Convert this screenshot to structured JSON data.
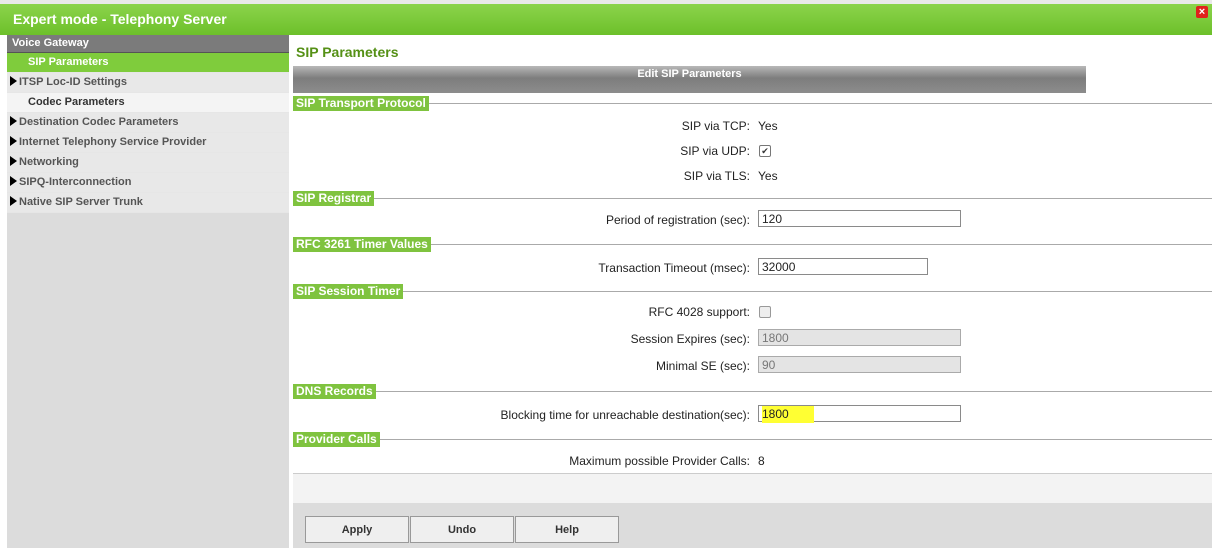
{
  "window": {
    "title": "Expert mode - Telephony Server"
  },
  "sidebar": {
    "header": "Voice Gateway",
    "items": [
      {
        "label": "SIP Parameters",
        "active": true,
        "arrow": false
      },
      {
        "label": "ITSP Loc-ID Settings",
        "active": false,
        "arrow": true
      },
      {
        "label": "Codec Parameters",
        "active": false,
        "arrow": false
      },
      {
        "label": "Destination Codec Parameters",
        "active": false,
        "arrow": true
      },
      {
        "label": "Internet Telephony Service Provider",
        "active": false,
        "arrow": true
      },
      {
        "label": "Networking",
        "active": false,
        "arrow": true
      },
      {
        "label": "SIPQ-Interconnection",
        "active": false,
        "arrow": true
      },
      {
        "label": "Native SIP Server Trunk",
        "active": false,
        "arrow": true
      }
    ]
  },
  "main": {
    "title": "SIP Parameters",
    "edit_bar": "Edit SIP Parameters",
    "sections": {
      "transport": {
        "title": "SIP Transport Protocol",
        "tcp_label": "SIP via TCP:",
        "tcp_value": "Yes",
        "udp_label": "SIP via UDP:",
        "udp_checked": true,
        "tls_label": "SIP via TLS:",
        "tls_value": "Yes"
      },
      "registrar": {
        "title": "SIP Registrar",
        "period_label": "Period of registration (sec):",
        "period_value": "120"
      },
      "rfc3261": {
        "title": "RFC 3261 Timer Values",
        "timeout_label": "Transaction Timeout (msec):",
        "timeout_value": "32000"
      },
      "session": {
        "title": "SIP Session Timer",
        "rfc4028_label": "RFC 4028 support:",
        "rfc4028_checked": false,
        "expires_label": "Session Expires (sec):",
        "expires_value": "1800",
        "minse_label": "Minimal SE (sec):",
        "minse_value": "90"
      },
      "dns": {
        "title": "DNS Records",
        "blocking_label": "Blocking time for unreachable destination(sec):",
        "blocking_value": "1800"
      },
      "provider": {
        "title": "Provider Calls",
        "max_label": "Maximum possible Provider Calls:",
        "max_value": "8"
      }
    },
    "buttons": {
      "apply": "Apply",
      "undo": "Undo",
      "help": "Help"
    }
  },
  "colors": {
    "accent": "#7fc33f",
    "title_green": "#559016",
    "highlight": "#ffff33",
    "close_red": "#e0201c"
  }
}
